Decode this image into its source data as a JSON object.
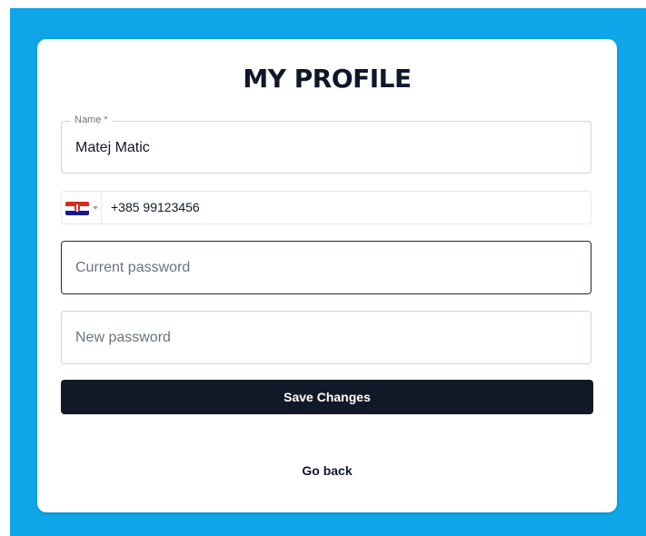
{
  "page": {
    "title": "MY PROFILE"
  },
  "form": {
    "name": {
      "label": "Name *",
      "value": "Matej Matic"
    },
    "phone": {
      "country_flag": "croatia-flag-icon",
      "value": "+385 99123456"
    },
    "current_password": {
      "placeholder": "Current password"
    },
    "new_password": {
      "placeholder": "New password"
    },
    "save_label": "Save Changes"
  },
  "footer": {
    "go_back_label": "Go back"
  },
  "colors": {
    "background": "#0ea5e9",
    "button": "#111827"
  }
}
